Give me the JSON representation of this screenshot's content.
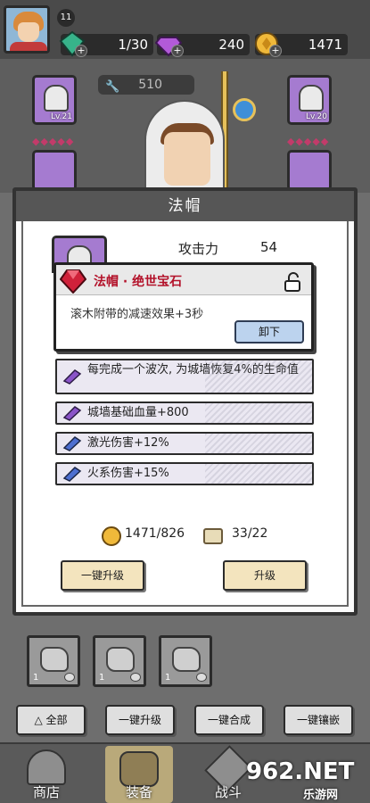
{
  "player": {
    "level": "11"
  },
  "resources": {
    "energy": "1/30",
    "gems": "240",
    "gold": "1471"
  },
  "hero": {
    "power": "510",
    "left_slot_level": "Lv.21",
    "right_slot_level": "Lv.20"
  },
  "dialog": {
    "title": "法帽",
    "stat_label": "攻击力",
    "stat_value": "54",
    "gem": {
      "name": "法帽 · 绝世宝石",
      "description": "滚木附带的减速效果+3秒",
      "unload_label": "卸下"
    },
    "attributes": [
      "每完成一个波次, 为城墙恢复4%的生命值",
      "城墙基础血量+800",
      "激光伤害+12%",
      "火系伤害+15%"
    ],
    "gold_cost": "1471/826",
    "scroll_cost": "33/22",
    "one_key_upgrade": "一键升级",
    "upgrade": "升级"
  },
  "backpack": [
    {
      "count": "1"
    },
    {
      "count": "1"
    },
    {
      "count": "1"
    }
  ],
  "actions": {
    "all": "全部",
    "one_key_upgrade": "一键升级",
    "one_key_merge": "一键合成",
    "one_key_inlay": "一键镶嵌"
  },
  "nav": {
    "shop": "商店",
    "equip": "装备",
    "battle": "战斗"
  },
  "watermark": {
    "main": "962.NET",
    "sub": "乐游网"
  }
}
